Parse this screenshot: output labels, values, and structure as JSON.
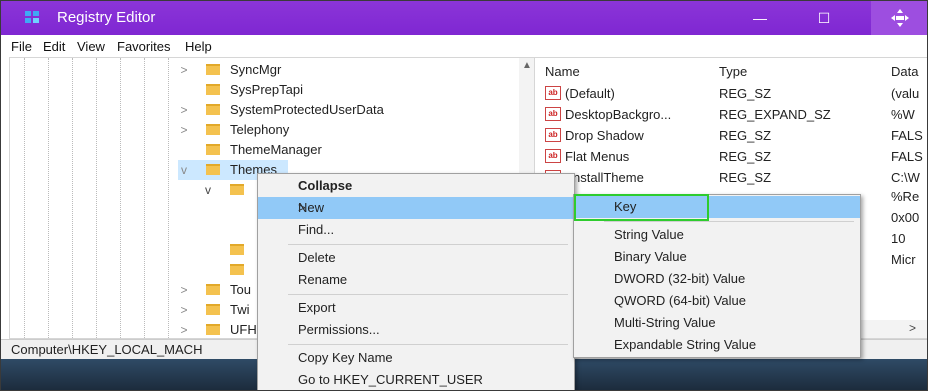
{
  "window": {
    "title": "Registry Editor",
    "controls": {
      "minimize": "—",
      "maximize": "☐"
    }
  },
  "menubar": {
    "items": [
      "File",
      "Edit",
      "View",
      "Favorites",
      "Help"
    ]
  },
  "tree": {
    "items": [
      {
        "label": "SyncMgr",
        "expander": ">"
      },
      {
        "label": "SysPrepTapi",
        "expander": ""
      },
      {
        "label": "SystemProtectedUserData",
        "expander": ">"
      },
      {
        "label": "Telephony",
        "expander": ">"
      },
      {
        "label": "ThemeManager",
        "expander": ""
      },
      {
        "label": "Themes",
        "expander": "v"
      },
      {
        "label": "Tou",
        "expander": ">"
      },
      {
        "label": "Twi",
        "expander": ">"
      },
      {
        "label": "UFH",
        "expander": ">"
      }
    ]
  },
  "list": {
    "columns": [
      "Name",
      "Type",
      "Data"
    ],
    "rows": [
      {
        "name": "(Default)",
        "type": "REG_SZ",
        "data": "(valu"
      },
      {
        "name": "DesktopBackgro...",
        "type": "REG_EXPAND_SZ",
        "data": "%W"
      },
      {
        "name": "Drop Shadow",
        "type": "REG_SZ",
        "data": "FALS"
      },
      {
        "name": "Flat Menus",
        "type": "REG_SZ",
        "data": "FALS"
      },
      {
        "name": "nstallTheme",
        "type": "REG_SZ",
        "data": "C:\\W"
      },
      {
        "name": "",
        "type": "",
        "data": "%Re"
      },
      {
        "name": "",
        "type": "",
        "data": "0x00"
      },
      {
        "name": "",
        "type": "",
        "data": "10"
      },
      {
        "name": "",
        "type": "",
        "data": "Micr"
      }
    ],
    "hscroll_right": ">"
  },
  "status": {
    "path": "Computer\\HKEY_LOCAL_MACH"
  },
  "context_menu": {
    "items": [
      "Collapse",
      "New",
      "Find...",
      "Delete",
      "Rename",
      "Export",
      "Permissions...",
      "Copy Key Name",
      "Go to HKEY_CURRENT_USER"
    ],
    "new_arrow": ">"
  },
  "submenu": {
    "items": [
      "Key",
      "String Value",
      "Binary Value",
      "DWORD (32-bit) Value",
      "QWORD (64-bit) Value",
      "Multi-String Value",
      "Expandable String Value"
    ]
  },
  "icons": {
    "app": "registry-icon",
    "folder": "folder-icon",
    "string_value": "ab-string-icon"
  },
  "colors": {
    "titlebar": "#8b35d8",
    "highlight": "#91c9f7",
    "folder": "#f4c24f",
    "annotation": "#2ecc2e"
  }
}
